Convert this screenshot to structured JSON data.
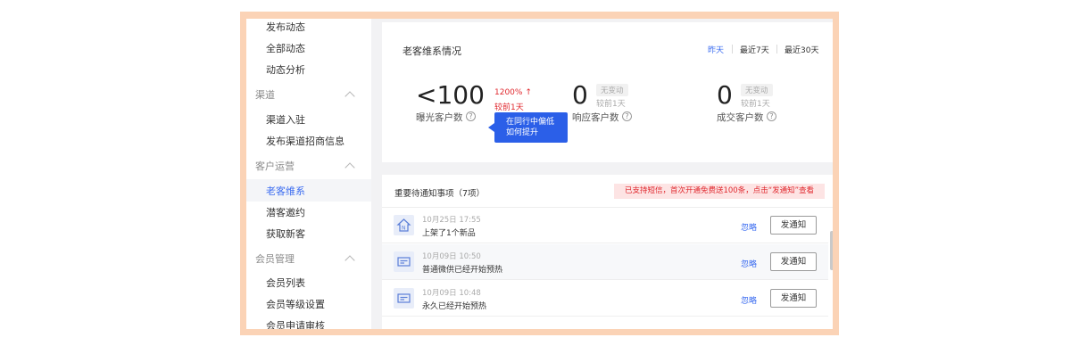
{
  "sidebar": {
    "items": [
      {
        "label": "发布动态",
        "type": "item"
      },
      {
        "label": "全部动态",
        "type": "item"
      },
      {
        "label": "动态分析",
        "type": "item"
      },
      {
        "label": "渠道",
        "type": "group"
      },
      {
        "label": "渠道入驻",
        "type": "item"
      },
      {
        "label": "发布渠道招商信息",
        "type": "item"
      },
      {
        "label": "客户运营",
        "type": "group"
      },
      {
        "label": "老客维系",
        "type": "item",
        "active": true
      },
      {
        "label": "潜客邀约",
        "type": "item"
      },
      {
        "label": "获取新客",
        "type": "item"
      },
      {
        "label": "会员管理",
        "type": "group"
      },
      {
        "label": "会员列表",
        "type": "item"
      },
      {
        "label": "会员等级设置",
        "type": "item"
      },
      {
        "label": "会员申请审核",
        "type": "item"
      }
    ]
  },
  "overview": {
    "title": "老客维系情况",
    "ranges": [
      "昨天",
      "最近7天",
      "最近30天"
    ],
    "active_range": "昨天",
    "metrics": [
      {
        "value": "<100",
        "label": "曝光客户数",
        "change": "1200% ↑",
        "change_sub": "较前1天",
        "trend": "up"
      },
      {
        "value": "0",
        "label": "响应客户数",
        "change": "无变动",
        "change_sub": "较前1天",
        "trend": "none"
      },
      {
        "value": "0",
        "label": "成交客户数",
        "change": "无变动",
        "change_sub": "较前1天",
        "trend": "none"
      }
    ],
    "tooltip": {
      "line1": "在同行中偏低",
      "line2": "如何提升"
    },
    "help_glyph": "?"
  },
  "notices": {
    "title": "重要待通知事项（7项）",
    "banner": "已支持短信，首次开通免费送100条，点击“发通知”查看",
    "rows": [
      {
        "icon": "store-icon",
        "time": "10月25日 17:55",
        "text": "上架了1个新品",
        "ignore": "忽略",
        "action": "发通知"
      },
      {
        "icon": "message-icon",
        "time": "10月09日 10:50",
        "text": "普通微供已经开始预热",
        "ignore": "忽略",
        "action": "发通知"
      },
      {
        "icon": "message-icon",
        "time": "10月09日 10:48",
        "text": "永久已经开始预热",
        "ignore": "忽略",
        "action": "发通知"
      }
    ]
  },
  "colors": {
    "accent": "#3b6cf0",
    "danger": "#e0282e",
    "frame": "#fbd3b6",
    "tooltip": "#2b5fe8"
  }
}
